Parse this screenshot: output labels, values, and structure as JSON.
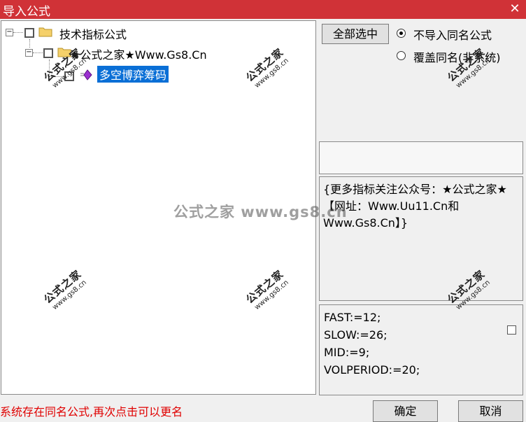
{
  "window": {
    "title": "导入公式",
    "close_glyph": "✕",
    "accent_color": "#d03237"
  },
  "tree": {
    "root": {
      "label": "技术指标公式",
      "expander": "⊟"
    },
    "group": {
      "label": "★公式之家★Www.Gs8.Cn",
      "expander": "⊟"
    },
    "item": {
      "label": "多空博弈筹码",
      "selected": true
    }
  },
  "options": {
    "select_all_label": "全部选中",
    "radio_skip_label": "不导入同名公式",
    "radio_overwrite_label": "覆盖同名(非系统)",
    "selected": "skip"
  },
  "description": {
    "text": "{更多指标关注公众号：★公式之家★【网址：Www.Uu11.Cn和Www.Gs8.Cn】}"
  },
  "code": {
    "lines": [
      "FAST:=12;",
      "SLOW:=26;",
      "MID:=9;",
      "VOLPERIOD:=20;"
    ]
  },
  "status_text": "系统存在同名公式,再次点击可以更名",
  "buttons": {
    "ok_label": "确定",
    "cancel_label": "取消"
  },
  "watermark": {
    "stamp_text": "公式之家",
    "stamp_url": "www.gs8.cn",
    "center_text": "公式之家 www.gs8.cn"
  }
}
